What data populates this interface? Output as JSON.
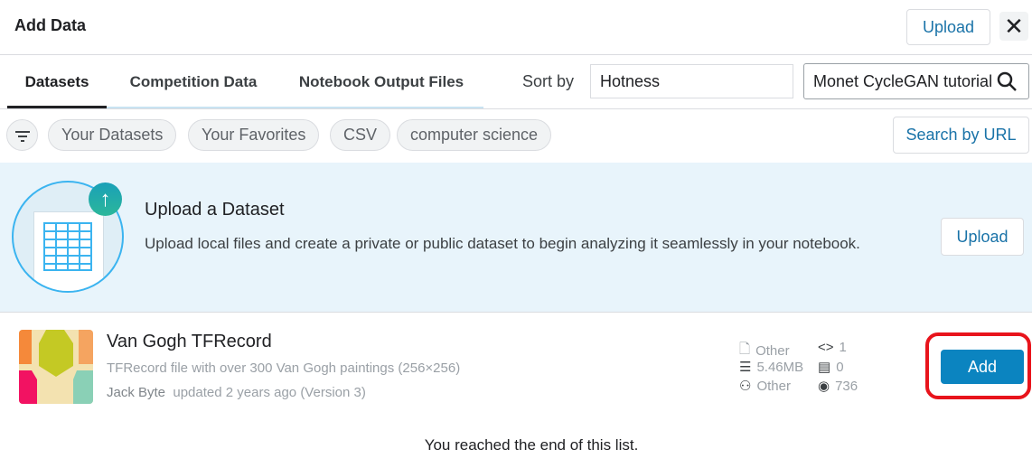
{
  "header": {
    "title": "Add Data",
    "upload_label": "Upload",
    "close_icon": "close-icon"
  },
  "tabs": [
    {
      "label": "Datasets",
      "active": true
    },
    {
      "label": "Competition Data"
    },
    {
      "label": "Notebook Output Files"
    }
  ],
  "sort": {
    "label": "Sort by",
    "value": "Hotness"
  },
  "search": {
    "value": "Monet CycleGAN tutorial"
  },
  "filters": {
    "chips": [
      "Your Datasets",
      "Your Favorites",
      "CSV",
      "computer science"
    ],
    "search_by_url": "Search by URL"
  },
  "banner": {
    "title": "Upload a Dataset",
    "description": "Upload local files and create a private or public dataset to begin analyzing it seamlessly in your notebook.",
    "button": "Upload"
  },
  "results": [
    {
      "title": "Van Gogh TFRecord",
      "subtitle": "TFRecord file with over 300 Van Gogh paintings (256×256)",
      "author": "Jack Byte",
      "updated": "updated 2 years ago (Version 3)",
      "file_type": "Other",
      "size": "5.46MB",
      "license": "Other",
      "notebooks": "1",
      "discussions": "0",
      "views": "736",
      "add_label": "Add"
    }
  ],
  "footer": "You reached the end of this list.",
  "colors": {
    "accent": "#0b84c0",
    "highlight": "#e8141c"
  }
}
